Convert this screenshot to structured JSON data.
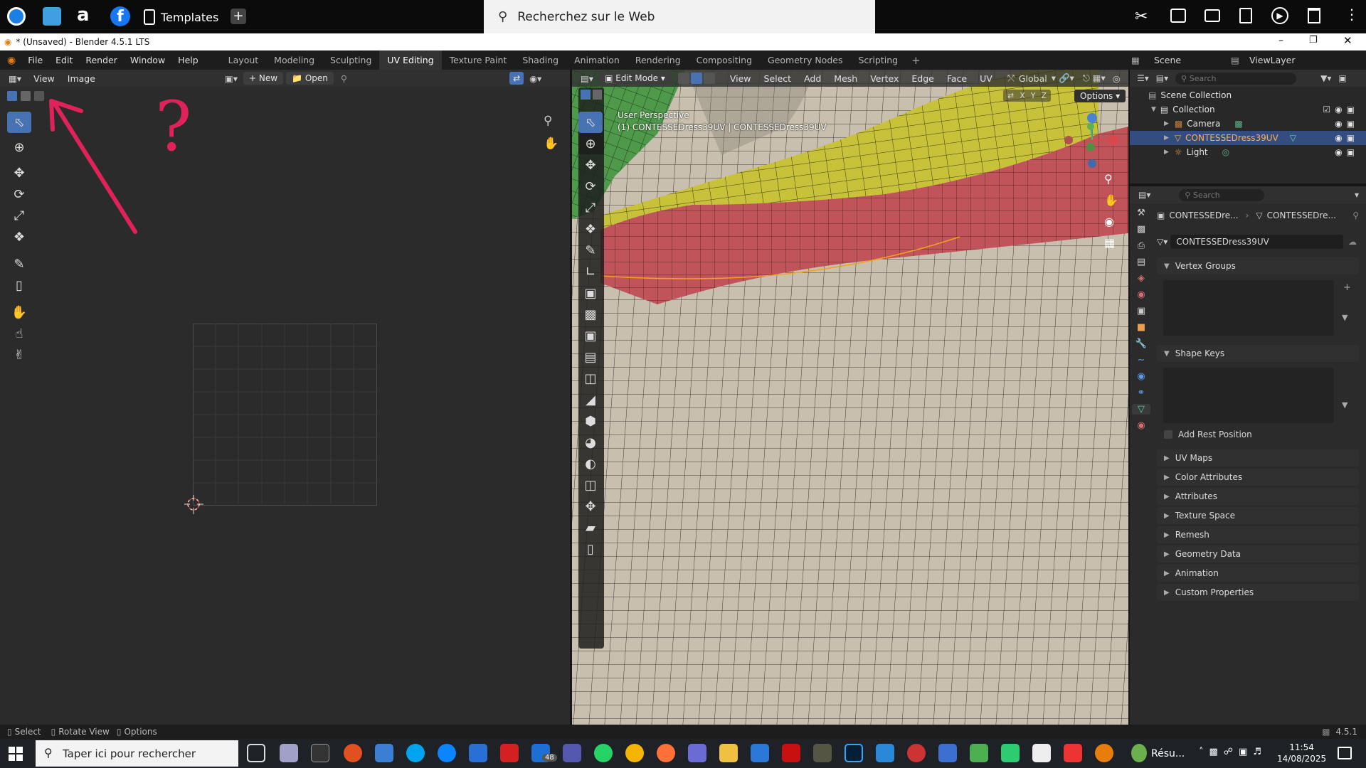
{
  "browser": {
    "templates_label": "Templates",
    "web_search": "Recherchez sur le Web"
  },
  "window": {
    "title": "* (Unsaved) - Blender 4.5.1 LTS"
  },
  "menu": [
    "File",
    "Edit",
    "Render",
    "Window",
    "Help"
  ],
  "workspaces": [
    "Layout",
    "Modeling",
    "Sculpting",
    "UV Editing",
    "Texture Paint",
    "Shading",
    "Animation",
    "Rendering",
    "Compositing",
    "Geometry Nodes",
    "Scripting"
  ],
  "active_workspace": "UV Editing",
  "scene": {
    "scene_label": "Scene",
    "view_layer": "ViewLayer"
  },
  "uv_editor": {
    "view": "View",
    "image": "Image",
    "new_btn": "New",
    "open_btn": "Open",
    "annotation": "?"
  },
  "viewport": {
    "mode": "Edit Mode",
    "menus": [
      "View",
      "Select",
      "Add",
      "Mesh",
      "Vertex",
      "Edge",
      "Face",
      "UV"
    ],
    "orientation": "Global",
    "options": "Options",
    "perspective": "User Perspective",
    "object_info": "(1) CONTESSEDress39UV | CONTESSEDress39UV",
    "axes": [
      "X",
      "Y",
      "Z"
    ]
  },
  "outliner": {
    "search_placeholder": "Search",
    "scene_collection": "Scene Collection",
    "collection": "Collection",
    "items": [
      "Camera",
      "CONTESSEDress39UV",
      "Light"
    ]
  },
  "properties": {
    "search_placeholder": "Search",
    "breadcrumb_obj": "CONTESSEDre...",
    "breadcrumb_data": "CONTESSEDre...",
    "mesh_name": "CONTESSEDress39UV",
    "vertex_groups": "Vertex Groups",
    "shape_keys": "Shape Keys",
    "add_rest_position": "Add Rest Position",
    "panels": [
      "UV Maps",
      "Color Attributes",
      "Attributes",
      "Texture Space",
      "Remesh",
      "Geometry Data",
      "Animation",
      "Custom Properties"
    ]
  },
  "status_bar": {
    "select": "Select",
    "rotate": "Rotate View",
    "options": "Options",
    "version": "4.5.1"
  },
  "taskbar": {
    "search": "Taper ici pour rechercher",
    "resu": "Résu...",
    "time": "11:54",
    "date": "14/08/2025",
    "badge": "48"
  },
  "colors": {
    "accent": "#4772b3",
    "annotation": "#e0225a",
    "selected_face": "#c7c23a",
    "red_faces": "#c0545a",
    "mesh_base": "#c9bfae"
  }
}
